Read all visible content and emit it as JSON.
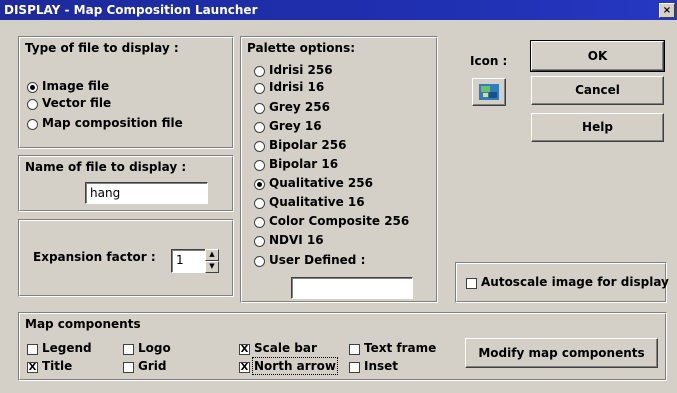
{
  "window": {
    "title": "DISPLAY - Map Composition Launcher",
    "close_glyph": "×"
  },
  "file_type": {
    "heading": "Type of file to display :",
    "options": [
      "Image file",
      "Vector file",
      "Map composition file"
    ],
    "selected": "Image file"
  },
  "file_name": {
    "heading": "Name of file to display :",
    "value": "hang"
  },
  "expansion": {
    "label": "Expansion factor :",
    "value": "1",
    "up_glyph": "▲",
    "down_glyph": "▼"
  },
  "palette": {
    "heading": "Palette options:",
    "options": [
      "Idrisi 256",
      "Idrisi 16",
      "Grey 256",
      "Grey 16",
      "Bipolar 256",
      "Bipolar 16",
      "Qualitative 256",
      "Qualitative 16",
      "Color Composite 256",
      "NDVI 16",
      "User Defined :"
    ],
    "selected": "Qualitative 256",
    "user_defined_value": ""
  },
  "icon_label": "Icon :",
  "buttons": {
    "ok": "OK",
    "cancel": "Cancel",
    "help": "Help",
    "modify": "Modify map components"
  },
  "autoscale": {
    "label": "Autoscale image for display",
    "checked": false
  },
  "map_components": {
    "heading": "Map components",
    "items": [
      {
        "label": "Legend",
        "checked": false
      },
      {
        "label": "Title",
        "checked": true
      },
      {
        "label": "Logo",
        "checked": false
      },
      {
        "label": "Grid",
        "checked": false
      },
      {
        "label": "Scale bar",
        "checked": true
      },
      {
        "label": "North arrow",
        "checked": true
      },
      {
        "label": "Text frame",
        "checked": false
      },
      {
        "label": "Inset",
        "checked": false
      }
    ],
    "check_glyph": "X"
  }
}
